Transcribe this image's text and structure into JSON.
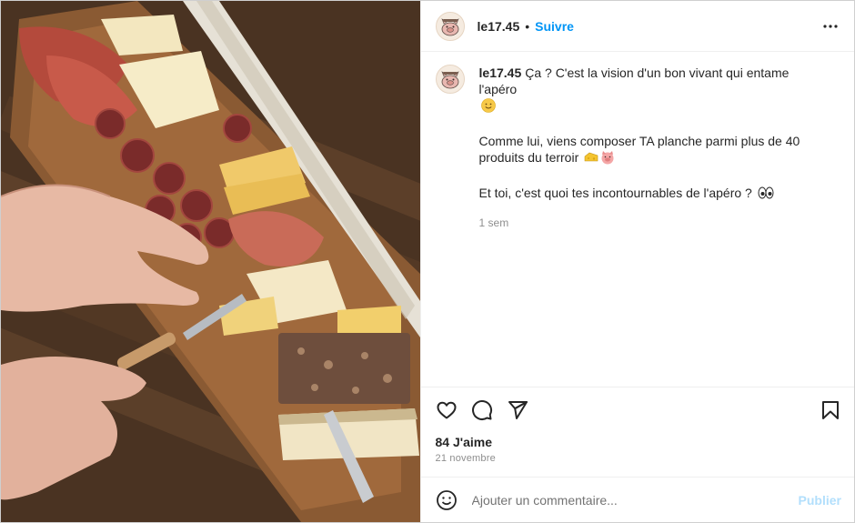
{
  "post": {
    "username": "le17.45",
    "separator": "•",
    "follow_label": "Suivre",
    "caption": {
      "line1": "Ça ? C'est la vision d'un bon vivant qui entame l'apéro",
      "line2": "Comme lui, viens composer TA planche parmi plus de 40 produits du terroir",
      "line3": "Et toi, c'est quoi tes incontournables de l'apéro ?",
      "relative_time": "1 sem"
    },
    "likes_label": "84 J'aime",
    "date_label": "21 novembre"
  },
  "comment": {
    "placeholder": "Ajouter un commentaire...",
    "publish_label": "Publier"
  },
  "icons": {
    "more": "more-options-icon",
    "like": "heart-icon",
    "comment": "comment-icon",
    "share": "send-icon",
    "save": "bookmark-icon",
    "emoji": "emoji-icon"
  },
  "colors": {
    "accent": "#0095f6",
    "publish_disabled": "#b2dffc",
    "muted": "#8e8e8e"
  }
}
